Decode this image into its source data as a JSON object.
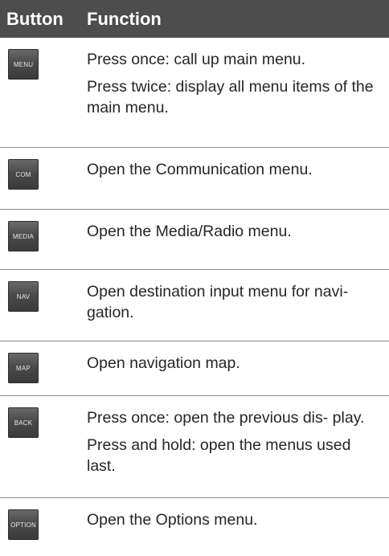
{
  "header": {
    "button_label": "Button",
    "function_label": "Function"
  },
  "rows": [
    {
      "button_label": "MENU",
      "lines": [
        "Press once: call up main menu.",
        "Press twice: display all menu items of the main menu."
      ]
    },
    {
      "button_label": "COM",
      "lines": [
        "Open the Communication menu."
      ]
    },
    {
      "button_label": "MEDIA",
      "lines": [
        "Open the Media/Radio menu."
      ]
    },
    {
      "button_label": "NAV",
      "lines": [
        "Open destination input menu for navi- gation."
      ]
    },
    {
      "button_label": "MAP",
      "lines": [
        "Open navigation map."
      ]
    },
    {
      "button_label": "BACK",
      "lines": [
        "Press once: open the previous dis- play.",
        "Press and hold: open the menus used last."
      ]
    },
    {
      "button_label": "OPTION",
      "lines": [
        "Open the Options menu."
      ]
    }
  ]
}
